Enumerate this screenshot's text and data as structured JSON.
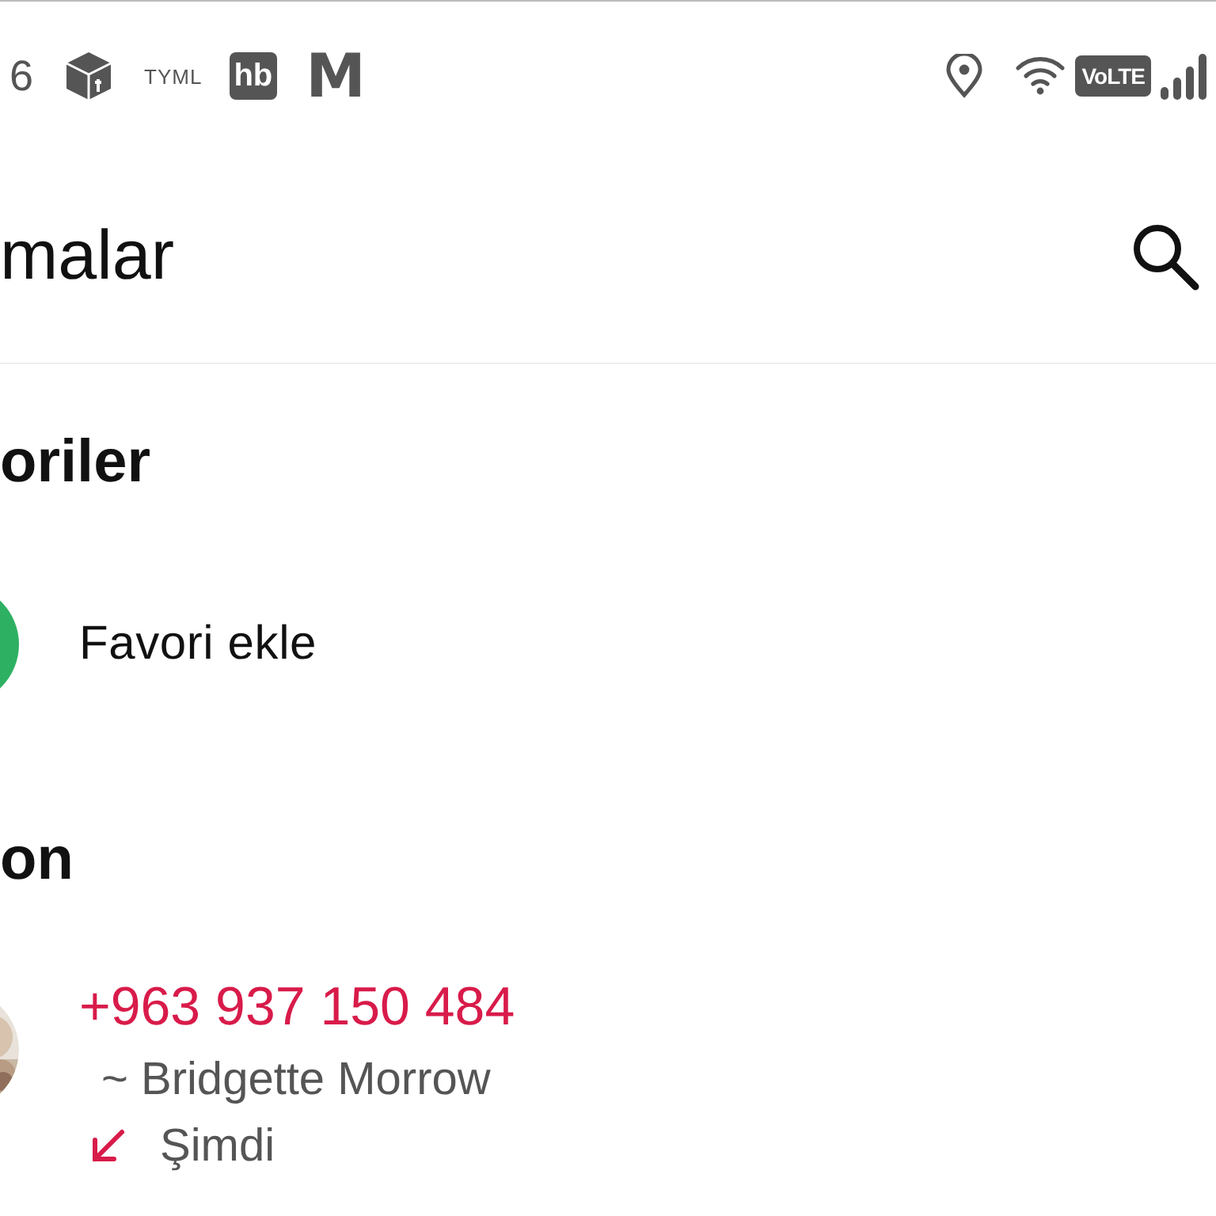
{
  "status_bar": {
    "clock": "6",
    "app_labels": [
      {
        "kind": "text",
        "label": "TYML"
      },
      {
        "kind": "badge",
        "label": "hb"
      },
      {
        "kind": "logo",
        "label": "M"
      }
    ],
    "network_badge": "VoLTE"
  },
  "header": {
    "title": "malar"
  },
  "sections": [
    {
      "title": "oriler",
      "items": [
        {
          "kind": "action",
          "label": "Favori ekle"
        }
      ]
    },
    {
      "title": "on",
      "items": [
        {
          "kind": "call",
          "number": "+963 937 150 484",
          "name": "~ Bridgette Morrow",
          "incoming": true,
          "missed": true,
          "time": "Şimdi"
        }
      ]
    }
  ]
}
